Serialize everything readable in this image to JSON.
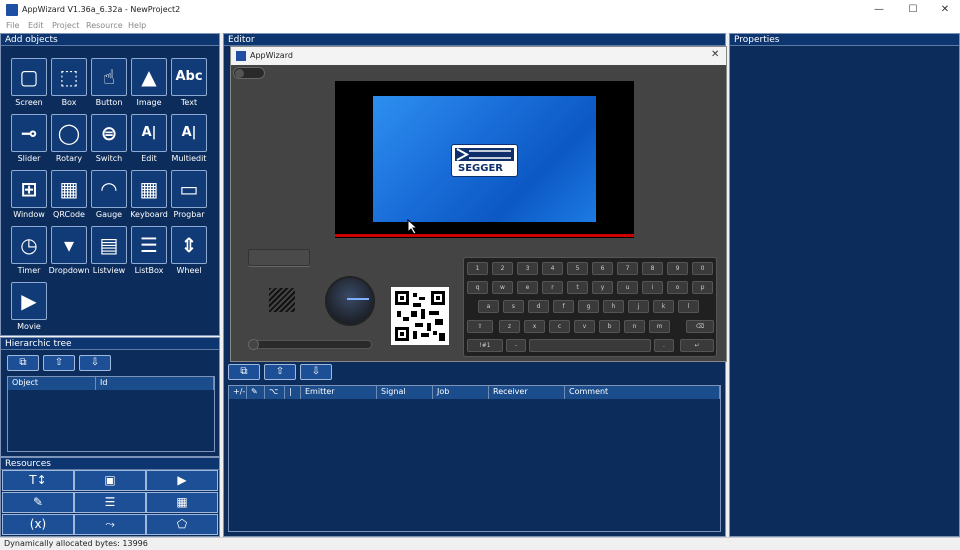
{
  "window": {
    "title": "AppWizard V1.36a_6.32a - NewProject2",
    "minimize": "—",
    "maximize": "☐",
    "close": "✕"
  },
  "menu": [
    "File",
    "Edit",
    "Project",
    "Resource",
    "Help"
  ],
  "add_objects": {
    "title": "Add objects",
    "items": [
      "Screen",
      "Box",
      "Button",
      "Image",
      "Text",
      "Slider",
      "Rotary",
      "Switch",
      "Edit",
      "Multiedit",
      "Window",
      "QRCode",
      "Gauge",
      "Keyboard",
      "Progbar",
      "Timer",
      "Dropdown",
      "Listview",
      "ListBox",
      "Wheel",
      "Movie"
    ]
  },
  "hierarchic_tree": {
    "title": "Hierarchic tree",
    "columns": [
      "Object",
      "Id"
    ]
  },
  "resources": {
    "title": "Resources"
  },
  "editor": {
    "title": "Editor"
  },
  "properties": {
    "title": "Properties"
  },
  "interactions": {
    "columns": [
      "+/-",
      "",
      "",
      "|",
      "Emitter",
      "Signal",
      "Job",
      "Receiver",
      "Comment"
    ]
  },
  "dialog": {
    "title": "AppWizard",
    "close": "✕",
    "logo_text": "SEGGER",
    "keyboard": {
      "row1": [
        "1",
        "2",
        "3",
        "4",
        "5",
        "6",
        "7",
        "8",
        "9",
        "0"
      ],
      "row2": [
        "q",
        "w",
        "e",
        "r",
        "t",
        "y",
        "u",
        "i",
        "o",
        "p"
      ],
      "row3": [
        "a",
        "s",
        "d",
        "f",
        "g",
        "h",
        "j",
        "k",
        "l"
      ],
      "row4": [
        "z",
        "x",
        "c",
        "v",
        "b",
        "n",
        "m"
      ],
      "row5_left": "!#1",
      "row5_dash": "-",
      "row5_dot": "."
    }
  },
  "status": {
    "text": "Dynamically allocated bytes: 13996"
  },
  "colors": {
    "panel_bg": "#0c2d5c",
    "header_bg": "#0d3570",
    "accent_red": "#cc0000"
  }
}
